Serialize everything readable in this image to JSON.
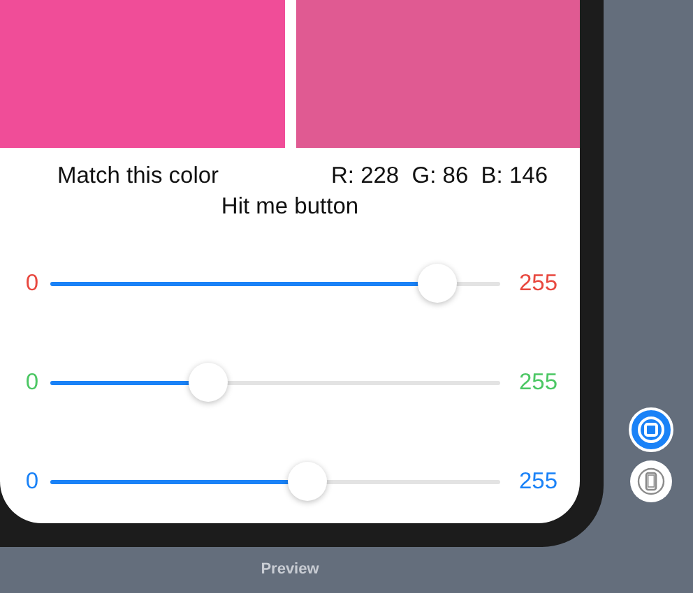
{
  "swatches": [
    {
      "color": "#f04d98"
    },
    {
      "color": "#e05a92"
    }
  ],
  "target_label": "Match this color",
  "rgb_readout": "R: 228  G: 86  B: 146",
  "hit_button": "Hit me button",
  "sliders": [
    {
      "min": "0",
      "max": "255",
      "color": "#e8483f",
      "level": 0.86
    },
    {
      "min": "0",
      "max": "255",
      "color": "#4cc764",
      "level": 0.35
    },
    {
      "min": "0",
      "max": "255",
      "color": "#1a82f7",
      "level": 0.57
    }
  ],
  "side_buttons": [
    {
      "kind": "live",
      "selected": true
    },
    {
      "kind": "device",
      "selected": false
    }
  ],
  "preview_label": "Preview"
}
